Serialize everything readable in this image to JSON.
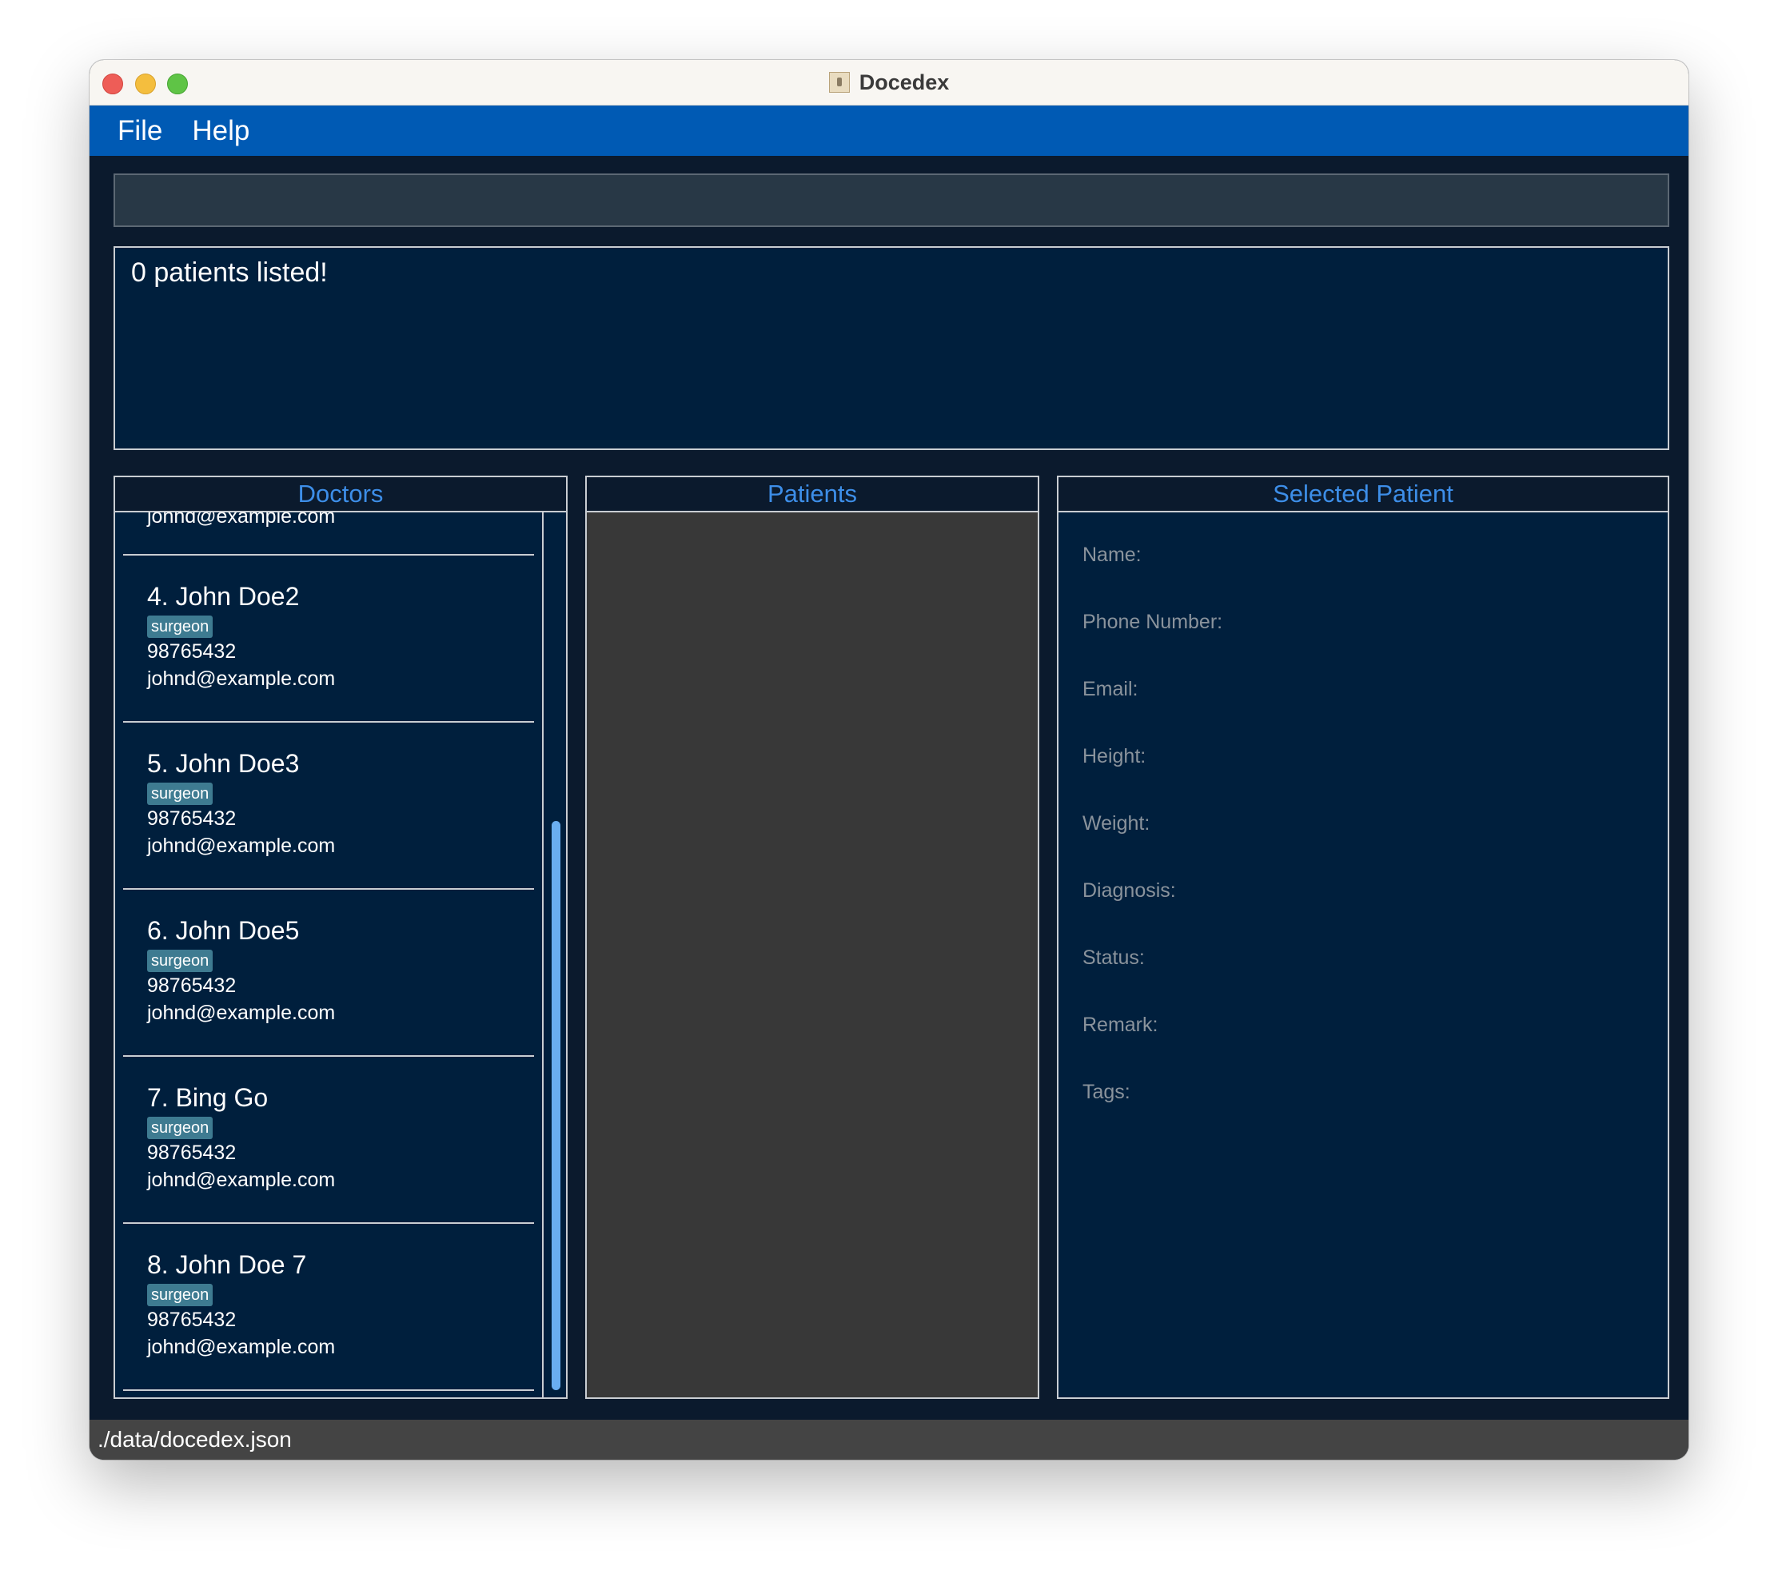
{
  "window": {
    "title": "Docedex"
  },
  "menu": {
    "file": "File",
    "help": "Help"
  },
  "command": {
    "value": "",
    "placeholder": ""
  },
  "result": {
    "message": "0 patients listed!"
  },
  "panels": {
    "doctors_title": "Doctors",
    "patients_title": "Patients",
    "selected_title": "Selected Patient"
  },
  "doctors": [
    {
      "name": "",
      "tag": "",
      "phone": "",
      "email": "johnd@example.com"
    },
    {
      "name": "4.  John Doe2",
      "tag": "surgeon",
      "phone": "98765432",
      "email": "johnd@example.com"
    },
    {
      "name": "5.  John Doe3",
      "tag": "surgeon",
      "phone": "98765432",
      "email": "johnd@example.com"
    },
    {
      "name": "6.  John Doe5",
      "tag": "surgeon",
      "phone": "98765432",
      "email": "johnd@example.com"
    },
    {
      "name": "7.  Bing Go",
      "tag": "surgeon",
      "phone": "98765432",
      "email": "johnd@example.com"
    },
    {
      "name": "8.  John Doe 7",
      "tag": "surgeon",
      "phone": "98765432",
      "email": "johnd@example.com"
    }
  ],
  "selected_patient": {
    "fields": [
      "Name:",
      "Phone Number:",
      "Email:",
      "Height:",
      "Weight:",
      "Diagnosis:",
      "Status:",
      "Remark:",
      "Tags:"
    ]
  },
  "status_bar": {
    "path": "./data/docedex.json"
  },
  "colors": {
    "menubar": "#005ab4",
    "background": "#0b1a2d",
    "panel": "#001f3d",
    "accent": "#3d8ee8",
    "tag": "#3e7b91"
  }
}
